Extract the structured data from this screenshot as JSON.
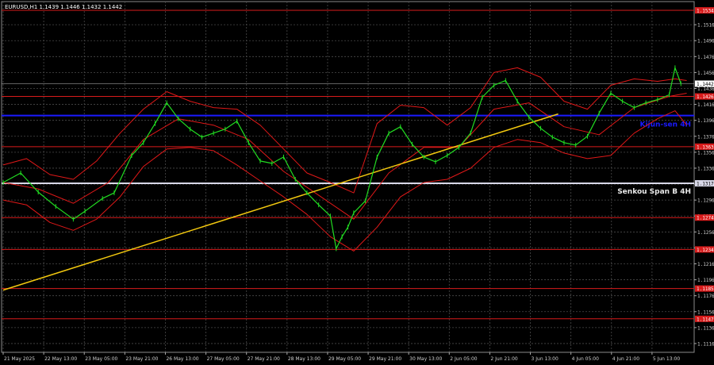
{
  "header": {
    "symbol_text": "EURUSD,H1  1.1439 1.1446 1.1432 1.1442"
  },
  "chart_data": {
    "type": "line",
    "symbol": "EURUSD,H1",
    "ohlc": {
      "open": 1.1439,
      "high": 1.1446,
      "low": 1.1432,
      "close": 1.1442
    },
    "ylim": [
      1.1105,
      1.1545
    ],
    "y_ticks": [
      "1.1516",
      "1.1496",
      "1.1476",
      "1.1456",
      "1.1436",
      "1.1416",
      "1.1396",
      "1.1376",
      "1.1356",
      "1.1336",
      "1.1316",
      "1.1296",
      "1.1276",
      "1.1256",
      "1.1236",
      "1.1216",
      "1.1196",
      "1.1176",
      "1.1156",
      "1.1136",
      "1.1116"
    ],
    "x_labels": [
      "21 May 2025",
      "22 May 13:00",
      "23 May 05:00",
      "23 May 21:00",
      "26 May 13:00",
      "27 May 05:00",
      "27 May 21:00",
      "28 May 13:00",
      "29 May 05:00",
      "29 May 21:00",
      "30 May 13:00",
      "2 Jun 05:00",
      "2 Jun 21:00",
      "3 Jun 13:00",
      "4 Jun 05:00",
      "4 Jun 21:00",
      "5 Jun 13:00"
    ],
    "grid": true,
    "current_price": "1.1442",
    "levels": [
      {
        "price": 1.1534,
        "label": "1.1534",
        "color": "#d81b1b"
      },
      {
        "price": 1.1426,
        "label": "1.1426",
        "color": "#d81b1b"
      },
      {
        "price": 1.1363,
        "label": "1.1363",
        "color": "#d81b1b"
      },
      {
        "price": 1.1274,
        "label": "1.1274",
        "color": "#d81b1b"
      },
      {
        "price": 1.1234,
        "label": "1.1234",
        "color": "#d81b1b"
      },
      {
        "price": 1.1185,
        "label": "1.1185",
        "color": "#d81b1b"
      },
      {
        "price": 1.1147,
        "label": "1.1147",
        "color": "#d81b1b"
      }
    ],
    "kijun": {
      "price": 1.1402,
      "label": "Kijun-sen 4H",
      "color": "#1a1aff"
    },
    "senkou": {
      "price": 1.1317,
      "label": "Senkou Span B 4H",
      "axis_label": "1.1317",
      "color": "#d8d8e8"
    },
    "trendline": {
      "color": "#f2c80f",
      "points": [
        [
          0,
          1.1183
        ],
        [
          95,
          1.1404
        ]
      ]
    },
    "price_series": [
      [
        0,
        1.1318
      ],
      [
        3,
        1.133
      ],
      [
        6,
        1.1306
      ],
      [
        9,
        1.1288
      ],
      [
        12,
        1.1272
      ],
      [
        14,
        1.1282
      ],
      [
        17,
        1.1298
      ],
      [
        19,
        1.1305
      ],
      [
        22,
        1.1352
      ],
      [
        24,
        1.1368
      ],
      [
        26,
        1.1392
      ],
      [
        28,
        1.1418
      ],
      [
        30,
        1.1398
      ],
      [
        32,
        1.1385
      ],
      [
        34,
        1.1375
      ],
      [
        36,
        1.138
      ],
      [
        38,
        1.1385
      ],
      [
        40,
        1.1395
      ],
      [
        42,
        1.1368
      ],
      [
        44,
        1.1345
      ],
      [
        46,
        1.1342
      ],
      [
        48,
        1.135
      ],
      [
        50,
        1.1322
      ],
      [
        52,
        1.1305
      ],
      [
        54,
        1.129
      ],
      [
        56,
        1.1276
      ],
      [
        57,
        1.1235
      ],
      [
        58,
        1.125
      ],
      [
        59,
        1.1262
      ],
      [
        60,
        1.128
      ],
      [
        62,
        1.1295
      ],
      [
        64,
        1.135
      ],
      [
        66,
        1.138
      ],
      [
        68,
        1.1388
      ],
      [
        70,
        1.1366
      ],
      [
        72,
        1.135
      ],
      [
        74,
        1.1344
      ],
      [
        76,
        1.1352
      ],
      [
        78,
        1.1362
      ],
      [
        80,
        1.138
      ],
      [
        82,
        1.1425
      ],
      [
        84,
        1.144
      ],
      [
        86,
        1.1446
      ],
      [
        88,
        1.142
      ],
      [
        90,
        1.14
      ],
      [
        92,
        1.1386
      ],
      [
        94,
        1.1375
      ],
      [
        96,
        1.1368
      ],
      [
        98,
        1.1365
      ],
      [
        100,
        1.1376
      ],
      [
        102,
        1.1405
      ],
      [
        104,
        1.143
      ],
      [
        106,
        1.142
      ],
      [
        108,
        1.1412
      ],
      [
        110,
        1.1418
      ],
      [
        112,
        1.1422
      ],
      [
        114,
        1.1428
      ],
      [
        115,
        1.1462
      ],
      [
        116,
        1.1442
      ]
    ],
    "bands_upper": [
      [
        0,
        1.134
      ],
      [
        4,
        1.1348
      ],
      [
        8,
        1.1328
      ],
      [
        12,
        1.1322
      ],
      [
        16,
        1.1345
      ],
      [
        20,
        1.138
      ],
      [
        24,
        1.141
      ],
      [
        28,
        1.1432
      ],
      [
        32,
        1.142
      ],
      [
        36,
        1.1412
      ],
      [
        40,
        1.141
      ],
      [
        44,
        1.139
      ],
      [
        48,
        1.136
      ],
      [
        52,
        1.133
      ],
      [
        56,
        1.1318
      ],
      [
        60,
        1.1305
      ],
      [
        64,
        1.1392
      ],
      [
        68,
        1.1415
      ],
      [
        72,
        1.1412
      ],
      [
        76,
        1.139
      ],
      [
        80,
        1.1412
      ],
      [
        84,
        1.1456
      ],
      [
        88,
        1.1462
      ],
      [
        92,
        1.145
      ],
      [
        96,
        1.142
      ],
      [
        100,
        1.141
      ],
      [
        104,
        1.144
      ],
      [
        108,
        1.1448
      ],
      [
        112,
        1.1445
      ],
      [
        115,
        1.1448
      ],
      [
        117,
        1.1446
      ]
    ],
    "bands_lower": [
      [
        0,
        1.1296
      ],
      [
        4,
        1.129
      ],
      [
        8,
        1.1268
      ],
      [
        12,
        1.1258
      ],
      [
        16,
        1.1272
      ],
      [
        20,
        1.13
      ],
      [
        24,
        1.1338
      ],
      [
        28,
        1.136
      ],
      [
        32,
        1.1362
      ],
      [
        36,
        1.1358
      ],
      [
        40,
        1.134
      ],
      [
        44,
        1.132
      ],
      [
        48,
        1.13
      ],
      [
        52,
        1.1278
      ],
      [
        56,
        1.125
      ],
      [
        60,
        1.1232
      ],
      [
        64,
        1.1262
      ],
      [
        68,
        1.13
      ],
      [
        72,
        1.1318
      ],
      [
        76,
        1.1322
      ],
      [
        80,
        1.1336
      ],
      [
        84,
        1.1362
      ],
      [
        88,
        1.1372
      ],
      [
        92,
        1.1368
      ],
      [
        96,
        1.1355
      ],
      [
        100,
        1.1348
      ],
      [
        104,
        1.1352
      ],
      [
        108,
        1.138
      ],
      [
        112,
        1.1398
      ],
      [
        115,
        1.1408
      ],
      [
        117,
        1.139
      ]
    ],
    "bands_middle": [
      [
        0,
        1.1318
      ],
      [
        6,
        1.131
      ],
      [
        12,
        1.1292
      ],
      [
        18,
        1.1318
      ],
      [
        24,
        1.1372
      ],
      [
        30,
        1.1398
      ],
      [
        36,
        1.139
      ],
      [
        42,
        1.1372
      ],
      [
        48,
        1.1332
      ],
      [
        54,
        1.1302
      ],
      [
        60,
        1.1272
      ],
      [
        66,
        1.133
      ],
      [
        72,
        1.1362
      ],
      [
        78,
        1.1362
      ],
      [
        84,
        1.141
      ],
      [
        90,
        1.1418
      ],
      [
        96,
        1.1388
      ],
      [
        102,
        1.1378
      ],
      [
        108,
        1.1412
      ],
      [
        114,
        1.1426
      ],
      [
        117,
        1.143
      ]
    ]
  }
}
